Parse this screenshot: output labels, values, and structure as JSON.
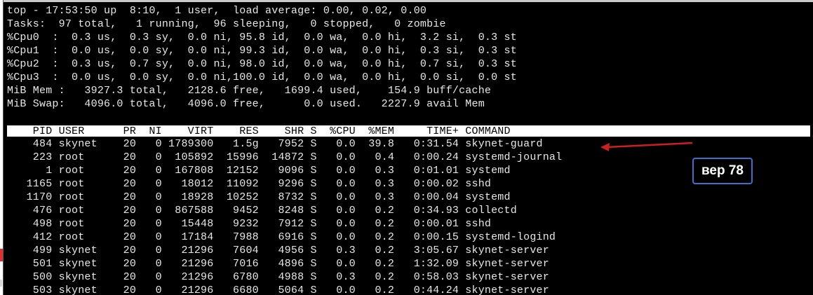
{
  "summary": {
    "line1": "top - 17:53:50 up  8:10,  1 user,  load average: 0.00, 0.02, 0.00",
    "tasks": "Tasks:  97 total,   1 running,  96 sleeping,   0 stopped,   0 zombie",
    "cpu": [
      "%Cpu0  :  0.3 us,  0.3 sy,  0.0 ni, 95.8 id,  0.0 wa,  0.0 hi,  3.2 si,  0.3 st",
      "%Cpu1  :  0.0 us,  0.0 sy,  0.0 ni, 99.3 id,  0.0 wa,  0.0 hi,  0.3 si,  0.3 st",
      "%Cpu2  :  0.3 us,  0.7 sy,  0.0 ni, 98.0 id,  0.0 wa,  0.0 hi,  0.7 si,  0.3 st",
      "%Cpu3  :  0.0 us,  0.0 sy,  0.0 ni,100.0 id,  0.0 wa,  0.0 hi,  0.0 si,  0.0 st"
    ],
    "mem": "MiB Mem :   3927.3 total,   2128.6 free,   1699.4 used,    154.9 buff/cache",
    "swap": "MiB Swap:   4096.0 total,   4096.0 free,      0.0 used.   2227.9 avail Mem"
  },
  "table": {
    "header": "    PID USER      PR  NI    VIRT    RES    SHR S  %CPU  %MEM     TIME+ COMMAND",
    "rows": [
      "    484 skynet    20   0 1789300   1.5g   7952 S   0.0  39.8   0:31.54 skynet-guard",
      "    223 root      20   0  105892  15996  14872 S   0.0   0.4   0:00.24 systemd-journal",
      "      1 root      20   0  167808  12152   9096 S   0.0   0.3   0:01.01 systemd",
      "   1165 root      20   0   18012  11092   9296 S   0.0   0.3   0:00.02 sshd",
      "   1170 root      20   0   18928  10252   8732 S   0.0   0.3   0:00.04 systemd",
      "    476 root      20   0  867588   9452   8248 S   0.0   0.2   0:34.93 collectd",
      "    498 root      20   0   15448   9232   7912 S   0.0   0.2   0:00.01 sshd",
      "    412 root      20   0   17184   7988   6916 S   0.0   0.2   0:00.15 systemd-logind",
      "    499 skynet    20   0   21296   7604   4956 S   0.3   0.2   3:05.67 skynet-server",
      "    501 skynet    20   0   21296   7016   4896 S   0.0   0.2   1:32.09 skynet-server",
      "    500 skynet    20   0   21296   6780   4988 S   0.3   0.2   0:58.03 skynet-server",
      "    503 skynet    20   0   21296   6680   5064 S   0.0   0.2   0:44.24 skynet-server"
    ]
  },
  "annotation": {
    "label": "вер 78",
    "arrow_color": "#cc1f1f",
    "border_color": "#3d6fd0"
  }
}
